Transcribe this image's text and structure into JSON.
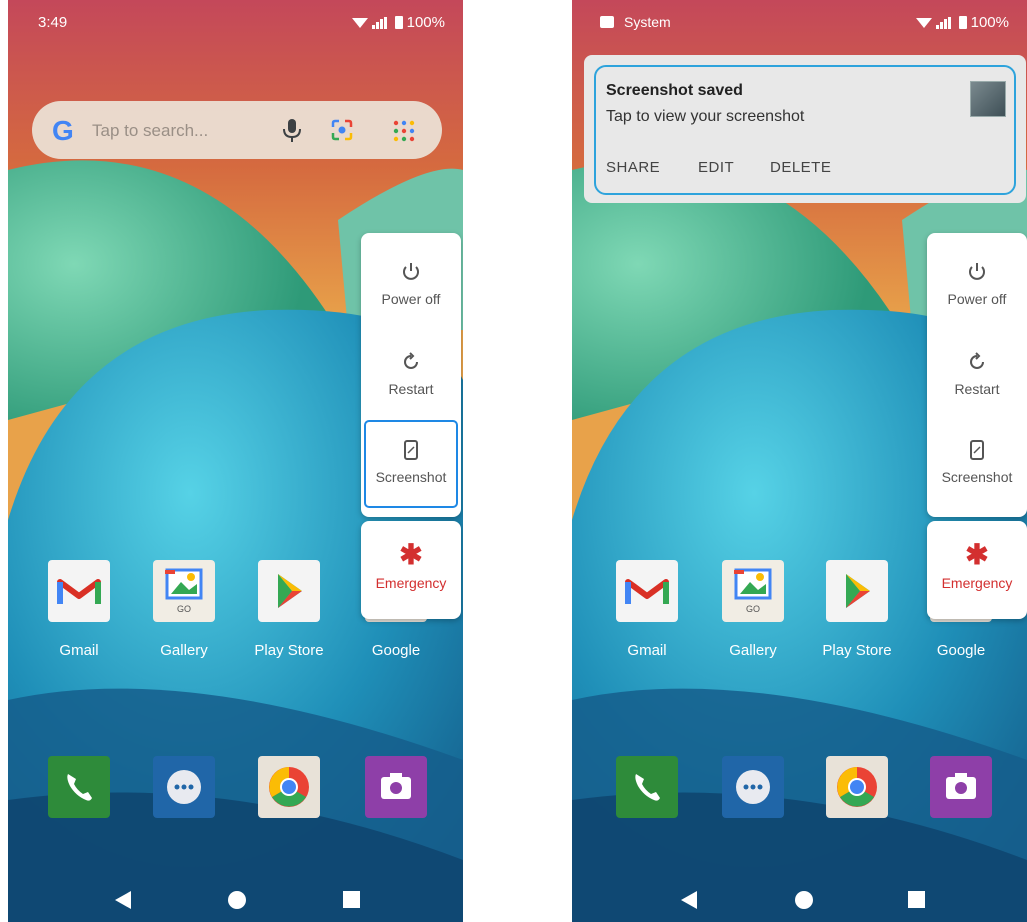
{
  "left_screen": {
    "status": {
      "time": "3:49",
      "battery": "100%"
    },
    "search": {
      "placeholder": "Tap to search..."
    },
    "power_menu": {
      "power_off": "Power off",
      "restart": "Restart",
      "screenshot": "Screenshot",
      "emergency": "Emergency",
      "selected": "Screenshot"
    },
    "apps": [
      {
        "label": "Gmail",
        "icon": "gmail-icon"
      },
      {
        "label": "Gallery",
        "icon": "gallery-icon"
      },
      {
        "label": "Play Store",
        "icon": "play-store-icon"
      },
      {
        "label": "Google",
        "icon": "google-icon"
      }
    ],
    "dock": [
      "phone-icon",
      "messages-icon",
      "chrome-icon",
      "camera-icon"
    ]
  },
  "right_screen": {
    "status": {
      "app": "System",
      "battery": "100%"
    },
    "notification": {
      "title": "Screenshot saved",
      "subtitle": "Tap to view your screenshot",
      "actions": {
        "share": "SHARE",
        "edit": "EDIT",
        "delete": "DELETE"
      }
    },
    "power_menu": {
      "power_off": "Power off",
      "restart": "Restart",
      "screenshot": "Screenshot",
      "emergency": "Emergency"
    },
    "apps": [
      {
        "label": "Gmail",
        "icon": "gmail-icon"
      },
      {
        "label": "Gallery",
        "icon": "gallery-icon"
      },
      {
        "label": "Play Store",
        "icon": "play-store-icon"
      },
      {
        "label": "Google",
        "icon": "google-icon"
      }
    ],
    "dock": [
      "phone-icon",
      "messages-icon",
      "chrome-icon",
      "camera-icon"
    ]
  },
  "colors": {
    "accent_outline": "#1e88e5",
    "notification_outline": "#2ea3dc",
    "emergency": "#d32f2f"
  }
}
